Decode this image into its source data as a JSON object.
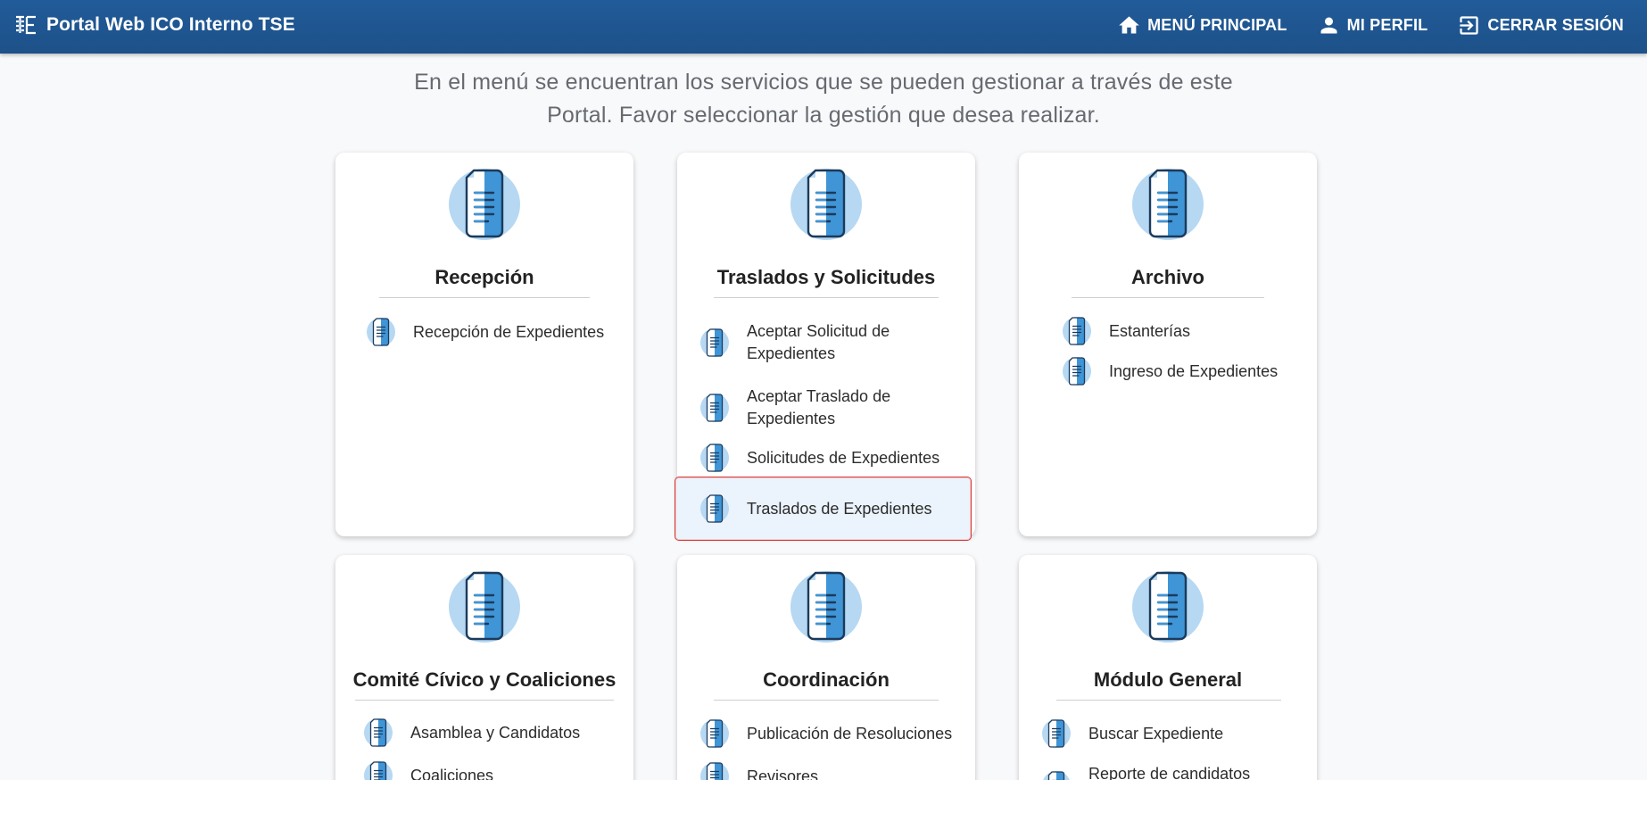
{
  "header": {
    "title": "Portal Web ICO Interno TSE",
    "nav": [
      {
        "label": "MENÚ PRINCIPAL",
        "icon": "home-icon"
      },
      {
        "label": "MI PERFIL",
        "icon": "user-icon"
      },
      {
        "label": "CERRAR SESIÓN",
        "icon": "logout-icon"
      }
    ]
  },
  "intro": {
    "line1": "En el menú se encuentran los servicios que se pueden gestionar a través de este",
    "line2": "Portal. Favor seleccionar la gestión que desea realizar."
  },
  "cards": [
    {
      "title": "Recepción",
      "items": [
        "Recepción de Expedientes"
      ]
    },
    {
      "title": "Traslados y Solicitudes",
      "items": [
        "Aceptar Solicitud de\nExpedientes",
        "Aceptar Traslado de\nExpedientes",
        "Solicitudes de Expedientes",
        "Traslados de Expedientes"
      ]
    },
    {
      "title": "Archivo",
      "items": [
        "Estanterías",
        "Ingreso de Expedientes"
      ]
    },
    {
      "title": "Comité Cívico y Coaliciones",
      "items": [
        "Asamblea y Candidatos",
        "Coaliciones"
      ]
    },
    {
      "title": "Coordinación",
      "items": [
        "Publicación de Resoluciones",
        "Revisores"
      ]
    },
    {
      "title": "Módulo General",
      "items": [
        "Buscar Expediente",
        "Reporte de candidatos\npostulados o Inscritos"
      ]
    }
  ],
  "colors": {
    "header_bg": "#215b99",
    "icon_light": "#b6d8f2",
    "icon_blue": "#3f95d6",
    "selected_border": "#d63a3a"
  }
}
